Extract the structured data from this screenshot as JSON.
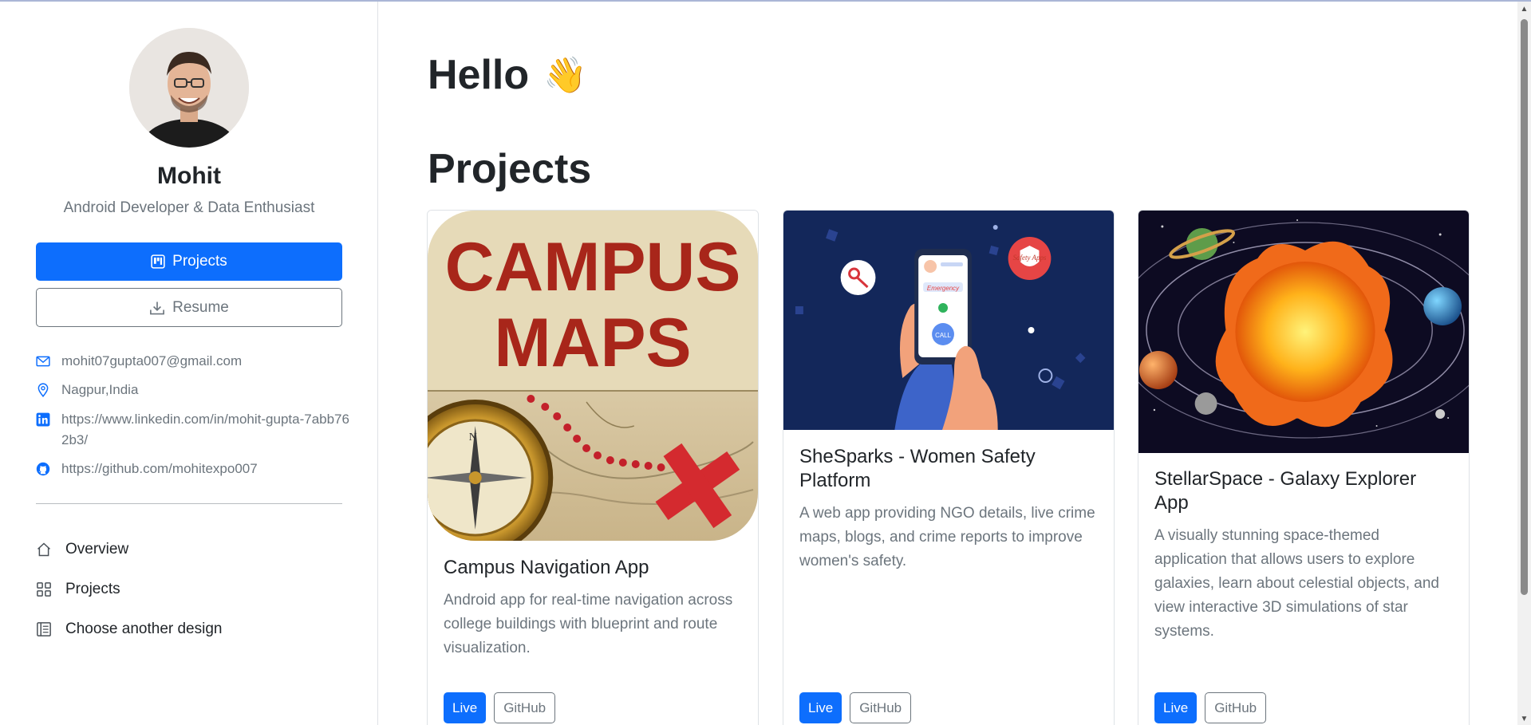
{
  "profile": {
    "name": "Mohit",
    "role": "Android Developer & Data Enthusiast",
    "avatar_alt": "profile photo"
  },
  "sidebar": {
    "projects_button": "Projects",
    "resume_button": "Resume",
    "contacts": {
      "email": "mohit07gupta007@gmail.com",
      "location": "Nagpur,India",
      "linkedin": "https://www.linkedin.com/in/mohit-gupta-7abb762b3/",
      "github": "https://github.com/mohitexpo007"
    },
    "nav": [
      {
        "label": "Overview",
        "icon": "house-icon"
      },
      {
        "label": "Projects",
        "icon": "grid-icon"
      },
      {
        "label": "Choose another design",
        "icon": "journal-icon"
      }
    ]
  },
  "main": {
    "greeting": "Hello",
    "greeting_emoji": "👋",
    "section_title": "Projects",
    "projects": [
      {
        "title": "Campus Navigation App",
        "description": "Android app for real-time navigation across college buildings with blueprint and route visualization.",
        "image_text_1": "CAMPUS",
        "image_text_2": "MAPS",
        "live_label": "Live",
        "github_label": "GitHub"
      },
      {
        "title": "SheSparks - Women Safety Platform",
        "description": "A web app providing NGO details, live crime maps, blogs, and crime reports to improve women's safety.",
        "image_badge": "Safety Apps",
        "image_label": "Emergency",
        "image_button": "CALL",
        "live_label": "Live",
        "github_label": "GitHub"
      },
      {
        "title": "StellarSpace - Galaxy Explorer App",
        "description": "A visually stunning space-themed application that allows users to explore galaxies, learn about celestial objects, and view interactive 3D simulations of star systems.",
        "live_label": "Live",
        "github_label": "GitHub"
      }
    ]
  },
  "colors": {
    "primary": "#0d6efd",
    "muted": "#6c757d",
    "text": "#212529",
    "border": "#dee2e6"
  }
}
